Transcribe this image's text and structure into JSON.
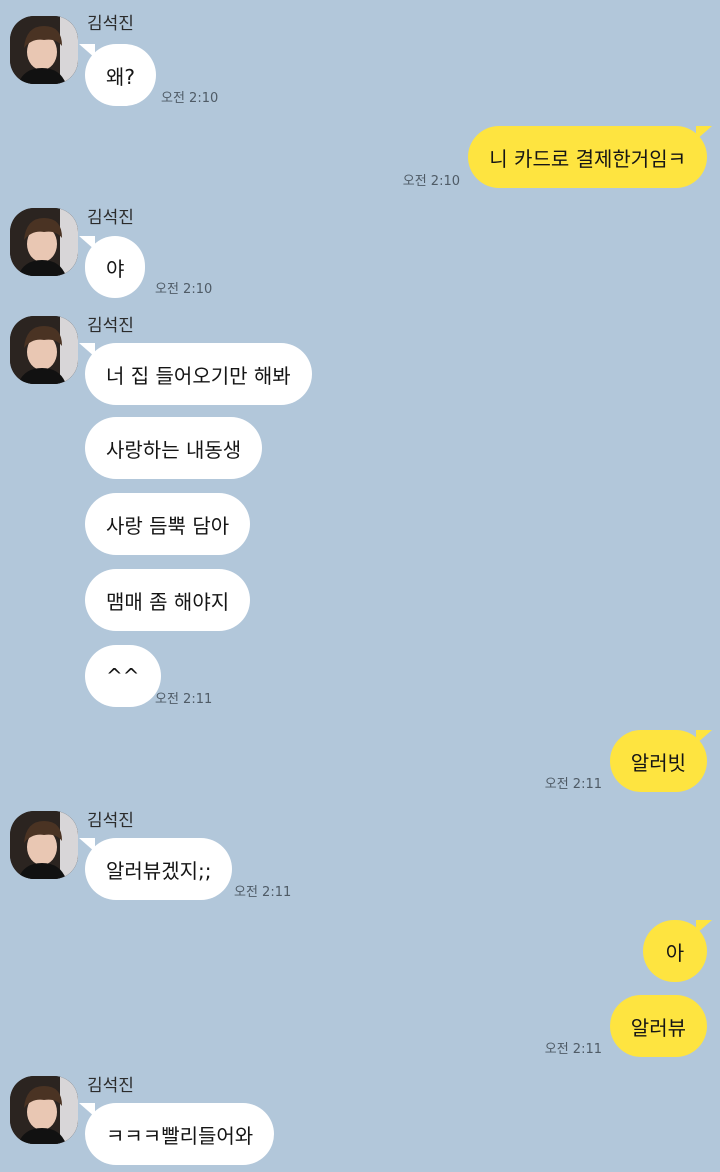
{
  "sender_name": "김석진",
  "messages": {
    "m1": "왜?",
    "m2": "니 카드로 결제한거임ㅋ",
    "m3": "야",
    "m4": "너 집 들어오기만 해봐",
    "m5": "사랑하는 내동생",
    "m6": "사랑 듬뿍 담아",
    "m7": "맴매 좀 해야지",
    "m8": "^^",
    "m9": "알러빗",
    "m10": "알러뷰겠지;;",
    "m11": "아",
    "m12": "알러뷰",
    "m13": "ㅋㅋㅋ빨리들어와"
  },
  "times": {
    "t1": "오전 2:10",
    "t2": "오전 2:10",
    "t3": "오전 2:10",
    "t4": "오전 2:11",
    "t5": "오전 2:11",
    "t6": "오전 2:11",
    "t7": "오전 2:11"
  },
  "colors": {
    "background": "#b2c7da",
    "incoming_bubble": "#ffffff",
    "outgoing_bubble": "#fee440"
  },
  "icons": {
    "profile": "profile-photo-avatar"
  }
}
